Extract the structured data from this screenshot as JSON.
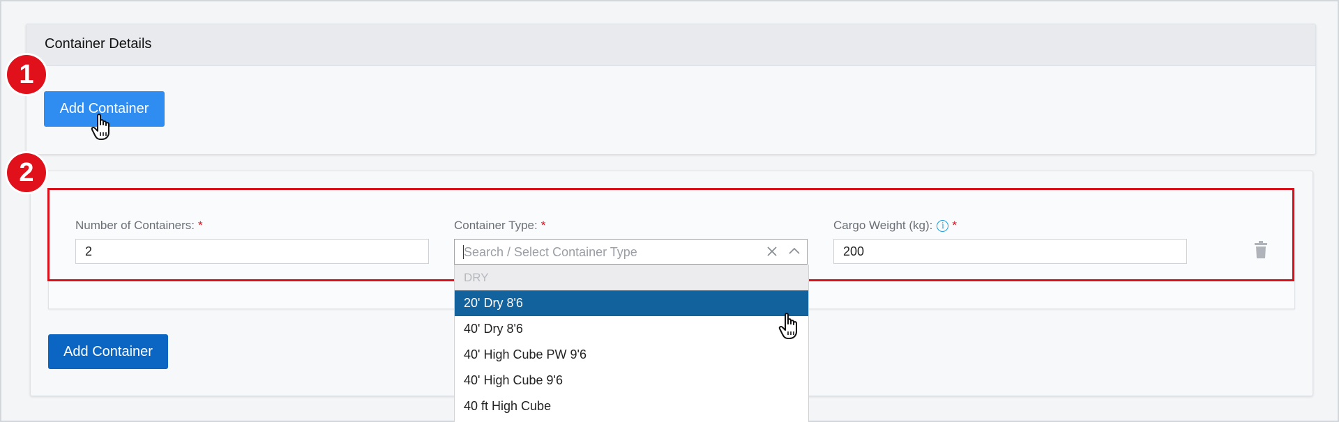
{
  "container_details": {
    "title": "Container Details",
    "add_button_label": "Add Container"
  },
  "steps": {
    "step1": "1",
    "step2": "2"
  },
  "container_row": {
    "num_label": "Number of Containers:",
    "num_value": "2",
    "type_label": "Container Type:",
    "type_placeholder": "Search / Select Container Type",
    "weight_label": "Cargo Weight (kg):",
    "weight_value": "200",
    "required_mark": "*"
  },
  "dropdown": {
    "group_label": "DRY",
    "options": [
      "20' Dry 8'6",
      "40' Dry 8'6",
      "40' High Cube PW 9'6",
      "40' High Cube 9'6",
      "40 ft High Cube"
    ],
    "selected_index": 0
  },
  "bottom_add_button_label": "Add Container",
  "icons": {
    "info": "info-icon",
    "clear": "close-icon",
    "chevron": "chevron-up-icon",
    "trash": "trash-icon",
    "cursor": "hand-pointer-icon"
  },
  "colors": {
    "primary_button": "#2f8cf0",
    "secondary_button": "#0a66c2",
    "selected_option": "#12629e",
    "badge": "#e0111b",
    "required": "#d9101a",
    "highlight_border": "#d9101a"
  }
}
